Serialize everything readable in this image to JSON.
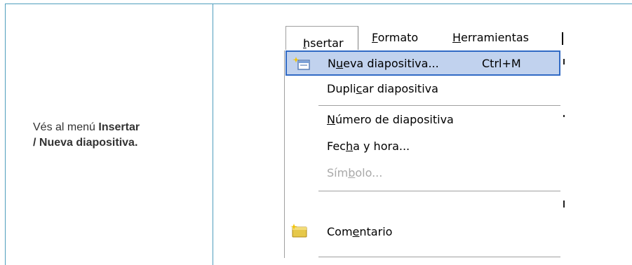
{
  "instruction": {
    "prefix": "Vés al menú ",
    "bold1": "Insertar",
    "bold2": "/ Nueva diapositiva."
  },
  "menubar": {
    "insertar": "Insertar",
    "formato": "Formato",
    "herramientas": "Herramientas"
  },
  "menu": {
    "items": [
      {
        "label_pre": "N",
        "label_ul": "u",
        "label_post": "eva diapositiva...",
        "shortcut": "Ctrl+M",
        "icon": "new-slide-icon",
        "state": "highlighted"
      },
      {
        "label_pre": "Dupli",
        "label_ul": "c",
        "label_post": "ar diapositiva",
        "state": "normal"
      },
      {
        "label_pre": "",
        "label_ul": "N",
        "label_post": "úmero de diapositiva",
        "state": "normal"
      },
      {
        "label_pre": "Fec",
        "label_ul": "h",
        "label_post": "a y hora...",
        "state": "normal"
      },
      {
        "label_pre": "Sím",
        "label_ul": "b",
        "label_post": "olo...",
        "state": "disabled"
      },
      {
        "label_pre": "Com",
        "label_ul": "e",
        "label_post": "ntario",
        "icon": "comment-icon",
        "state": "normal"
      }
    ]
  },
  "colors": {
    "frame": "#4f9ebd",
    "highlight_bg": "#c1d2ee",
    "highlight_border": "#316ac5",
    "disabled_text": "#a8a8a8"
  }
}
